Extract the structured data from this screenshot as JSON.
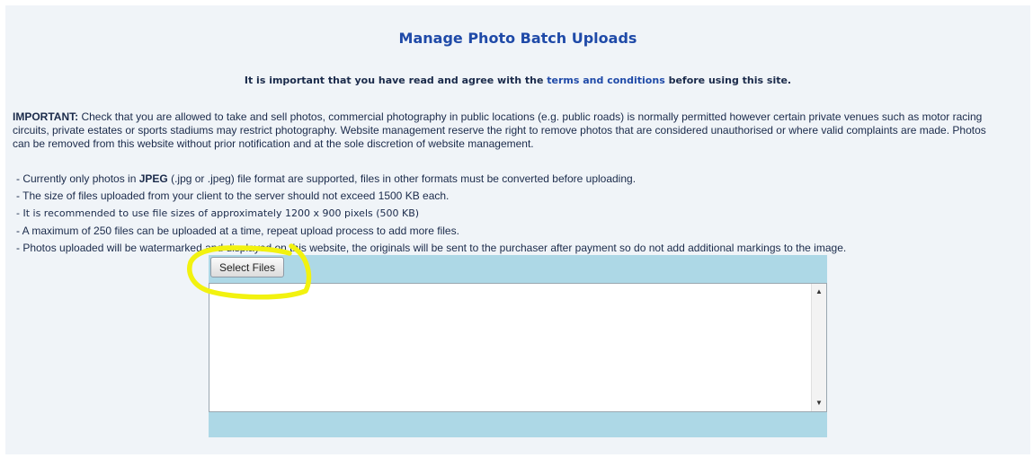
{
  "page": {
    "title": "Manage Photo Batch Uploads",
    "terms": {
      "before": "It is important that you have read and agree with the ",
      "link_text": "terms and conditions",
      "after": " before using this site."
    },
    "important": {
      "label": "IMPORTANT:",
      "text": " Check that you are allowed to take and sell photos, commercial photography in public locations (e.g. public roads) is normally permitted however certain private venues such as motor racing circuits, private estates or sports stadiums may restrict photography. Website management reserve the right to remove photos that are considered unauthorised or where valid complaints are made. Photos can be removed from this website without prior notification and at the sole discretion of website management."
    },
    "rules": {
      "jpeg_before": "- Currently only photos in ",
      "jpeg_bold": "JPEG",
      "jpeg_after": " (.jpg or .jpeg) file format are supported, files in other formats must be converted before uploading.",
      "size": "- The size of files uploaded from your client to the server should not exceed 1500 KB each.",
      "recommended": "- It is recommended to use file sizes of approximately 1200 x 900 pixels (500 KB)",
      "maximum": "- A maximum of 250 files can be uploaded at a time, repeat upload process to add more files.",
      "watermark": "- Photos uploaded will be watermarked and displayed on this website, the originals will be sent to the purchaser after payment so do not add additional markings to the image."
    }
  },
  "uploader": {
    "select_files_label": "Select Files",
    "scroll_up_glyph": "▲",
    "scroll_down_glyph": "▼"
  },
  "colors": {
    "title": "#1f4aa8",
    "panel_background": "#f0f4f8",
    "uploader_background": "#add8e6",
    "highlight": "#f2f20f"
  }
}
